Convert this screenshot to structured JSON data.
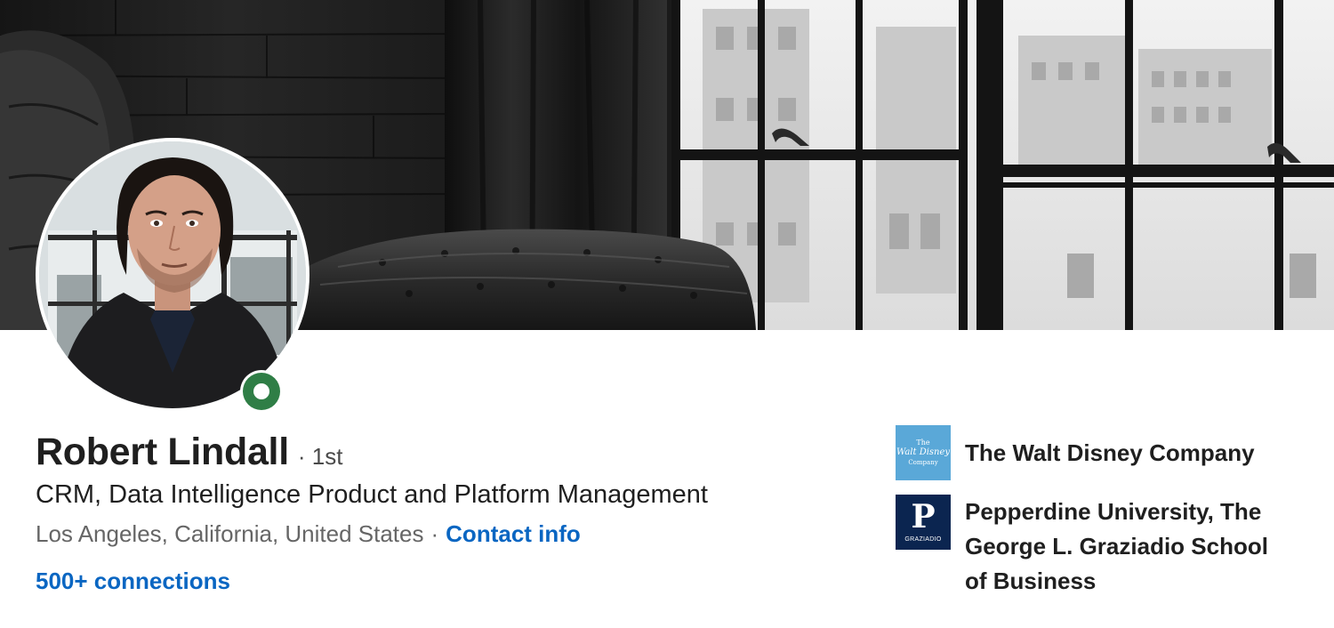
{
  "profile": {
    "name": "Robert Lindall",
    "degree": "· 1st",
    "headline": "CRM, Data Intelligence Product and Platform Management",
    "location": "Los Angeles, California, United States",
    "separator": "·",
    "contact_info_label": "Contact info",
    "connections_label": "500+ connections",
    "status": "open-to-work"
  },
  "organizations": [
    {
      "name": "The Walt Disney Company",
      "logo_text": [
        "The",
        "Walt Disney",
        "Company"
      ],
      "logo_color": "#5aa8d8"
    },
    {
      "name": "Pepperdine University, The George L. Graziadio School of Business",
      "logo_text": [
        "P",
        "GRAZIADIO"
      ],
      "logo_color": "#0b2550"
    }
  ],
  "colors": {
    "link": "#0a66c2",
    "status_ring": "#2f7e46",
    "text_primary": "#1f1f1f",
    "text_secondary": "#666666"
  },
  "icons": {
    "status": "open-to-work-ring-icon"
  }
}
